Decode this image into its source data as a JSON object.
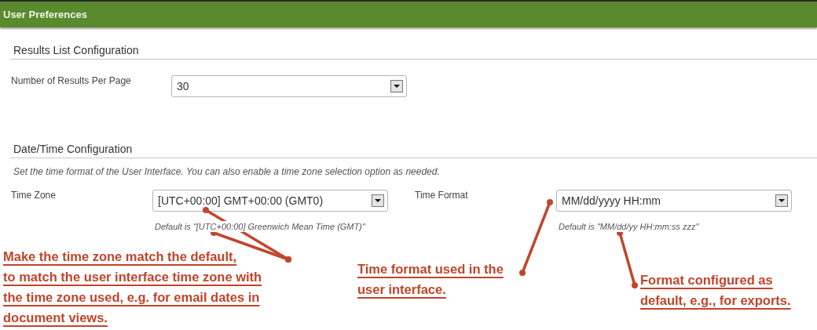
{
  "header": {
    "title": "User Preferences"
  },
  "sections": [
    {
      "title": "Results List Configuration",
      "fields": [
        {
          "label": "Number of Results Per Page",
          "value": "30"
        }
      ]
    },
    {
      "title": "Date/Time Configuration",
      "description": "Set the time format of the User Interface. You can also enable a time zone selection option as needed.",
      "fields": [
        {
          "label": "Time Zone",
          "value": "[UTC+00:00] GMT+00:00 (GMT0)",
          "hint": "Default is \"[UTC+00:00] Greenwich Mean Time (GMT)\""
        },
        {
          "label": "Time Format",
          "value": "MM/dd/yyyy HH:mm",
          "hint": "Default is \"MM/dd/yy HH:mm:ss zzz\""
        }
      ]
    }
  ],
  "annotations": [
    {
      "lines": [
        "Make the time zone match the default,",
        "to match the user interface time zone with",
        "the time zone used, e.g. for email dates in",
        "document views."
      ]
    },
    {
      "lines": [
        "Time format used in the",
        "user interface."
      ]
    },
    {
      "lines": [
        "Format configured as",
        "default, e.g., for exports."
      ]
    }
  ]
}
